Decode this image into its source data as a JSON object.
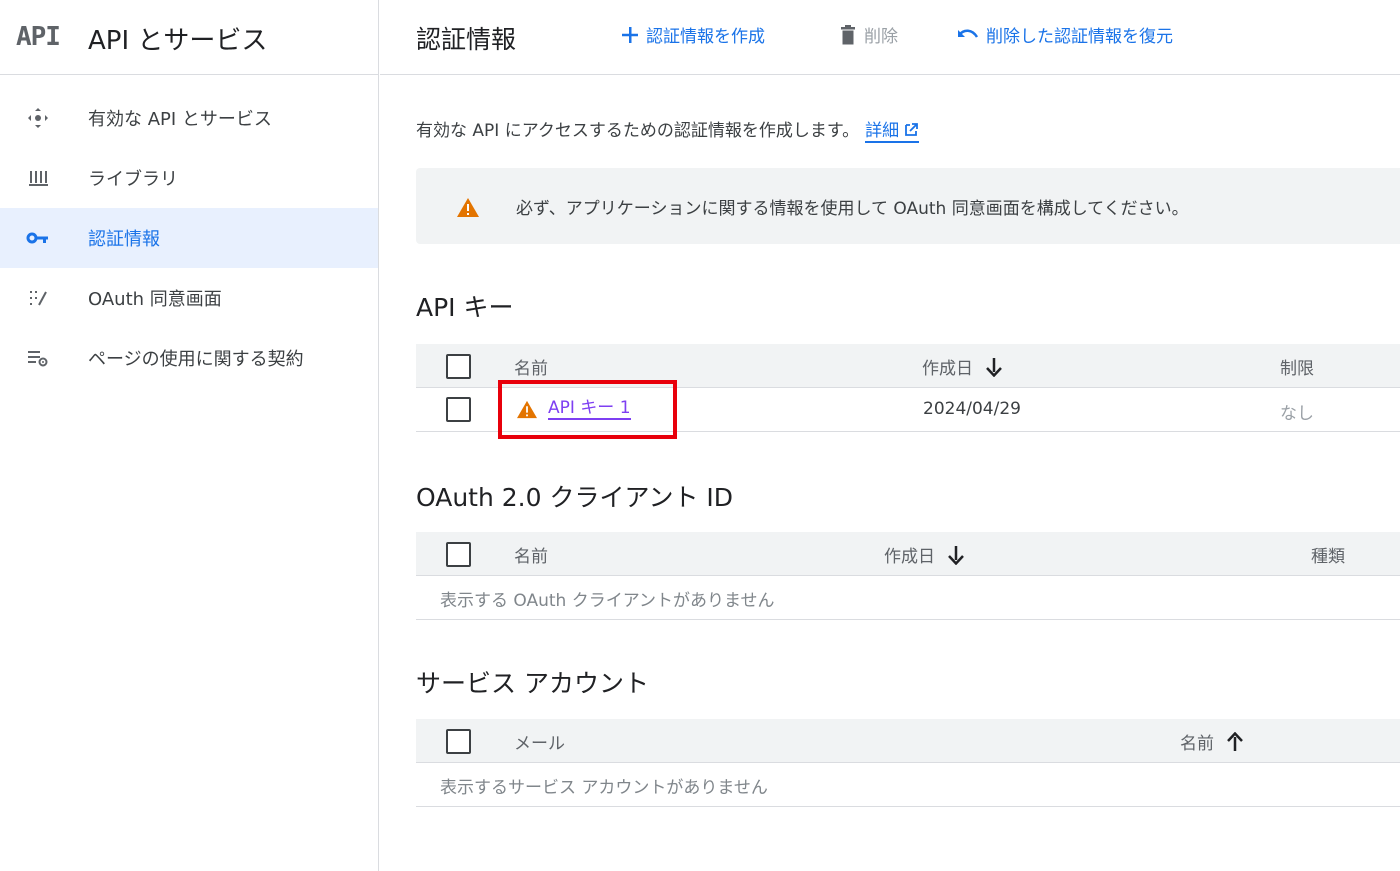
{
  "brand": {
    "logo": "API",
    "title": "API とサービス"
  },
  "sidebar": {
    "items": [
      {
        "label": "有効な API とサービス",
        "icon": "api-hub-icon",
        "active": false
      },
      {
        "label": "ライブラリ",
        "icon": "library-icon",
        "active": false
      },
      {
        "label": "認証情報",
        "icon": "key-icon",
        "active": true
      },
      {
        "label": "OAuth 同意画面",
        "icon": "consent-icon",
        "active": false
      },
      {
        "label": "ページの使用に関する契約",
        "icon": "settings-list-icon",
        "active": false
      }
    ]
  },
  "toolbar": {
    "title": "認証情報",
    "create_label": "認証情報を作成",
    "delete_label": "削除",
    "restore_label": "削除した認証情報を復元"
  },
  "intro": {
    "text": "有効な API にアクセスするための認証情報を作成します。",
    "link": "詳細"
  },
  "alert": {
    "text": "必ず、アプリケーションに関する情報を使用して OAuth 同意画面を構成してください。"
  },
  "api_keys": {
    "title": "API キー",
    "columns": {
      "name": "名前",
      "created": "作成日",
      "restriction": "制限"
    },
    "rows": [
      {
        "name": "API キー 1",
        "created": "2024/04/29",
        "restriction": "なし"
      }
    ]
  },
  "oauth": {
    "title": "OAuth 2.0 クライアント ID",
    "columns": {
      "name": "名前",
      "created": "作成日",
      "type": "種類"
    },
    "empty": "表示する OAuth クライアントがありません"
  },
  "service_accounts": {
    "title": "サービス アカウント",
    "columns": {
      "email": "メール",
      "name": "名前"
    },
    "empty": "表示するサービス アカウントがありません"
  },
  "colors": {
    "accent": "#1a73e8",
    "active_bg": "#e8f0fe",
    "warning": "#e37400",
    "highlight": "#e8000b",
    "visited_link": "#7e3ff2"
  }
}
